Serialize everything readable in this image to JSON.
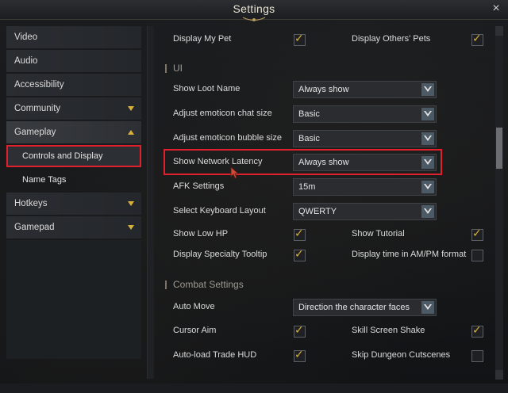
{
  "window": {
    "title": "Settings",
    "close": "×"
  },
  "sidebar": {
    "items": [
      {
        "label": "Video"
      },
      {
        "label": "Audio"
      },
      {
        "label": "Accessibility"
      },
      {
        "label": "Community"
      },
      {
        "label": "Gameplay"
      },
      {
        "label": "Controls and Display"
      },
      {
        "label": "Name Tags"
      },
      {
        "label": "Hotkeys"
      },
      {
        "label": "Gamepad"
      }
    ]
  },
  "main": {
    "top_row": {
      "left_label": "Display My Pet",
      "left_checked": true,
      "right_label": "Display Others' Pets",
      "right_checked": true
    },
    "sections": {
      "ui": "UI",
      "combat": "Combat Settings"
    },
    "dropdowns": [
      {
        "label": "Show Loot Name",
        "value": "Always show"
      },
      {
        "label": "Adjust emoticon chat size",
        "value": "Basic"
      },
      {
        "label": "Adjust emoticon bubble size",
        "value": "Basic"
      },
      {
        "label": "Show Network Latency",
        "value": "Always show"
      },
      {
        "label": "AFK Settings",
        "value": "15m"
      },
      {
        "label": "Select Keyboard Layout",
        "value": "QWERTY"
      }
    ],
    "checks_ui": [
      {
        "left_label": "Show Low HP",
        "left_checked": true,
        "right_label": "Show Tutorial",
        "right_checked": true
      },
      {
        "left_label": "Display Specialty Tooltip",
        "left_checked": true,
        "right_label": "Display time in AM/PM format",
        "right_checked": false
      }
    ],
    "combat": {
      "auto_move": {
        "label": "Auto Move",
        "value": "Direction the character faces"
      },
      "rows": [
        {
          "left_label": "Cursor Aim",
          "left_checked": true,
          "right_label": "Skill Screen Shake",
          "right_checked": true
        },
        {
          "left_label": "Auto-load Trade HUD",
          "left_checked": true,
          "right_label": "Skip Dungeon Cutscenes",
          "right_checked": false
        }
      ]
    }
  },
  "colors": {
    "accent": "#d8b13a",
    "highlight": "#e0202c",
    "dropdown_arrow": "#4c5a66"
  }
}
